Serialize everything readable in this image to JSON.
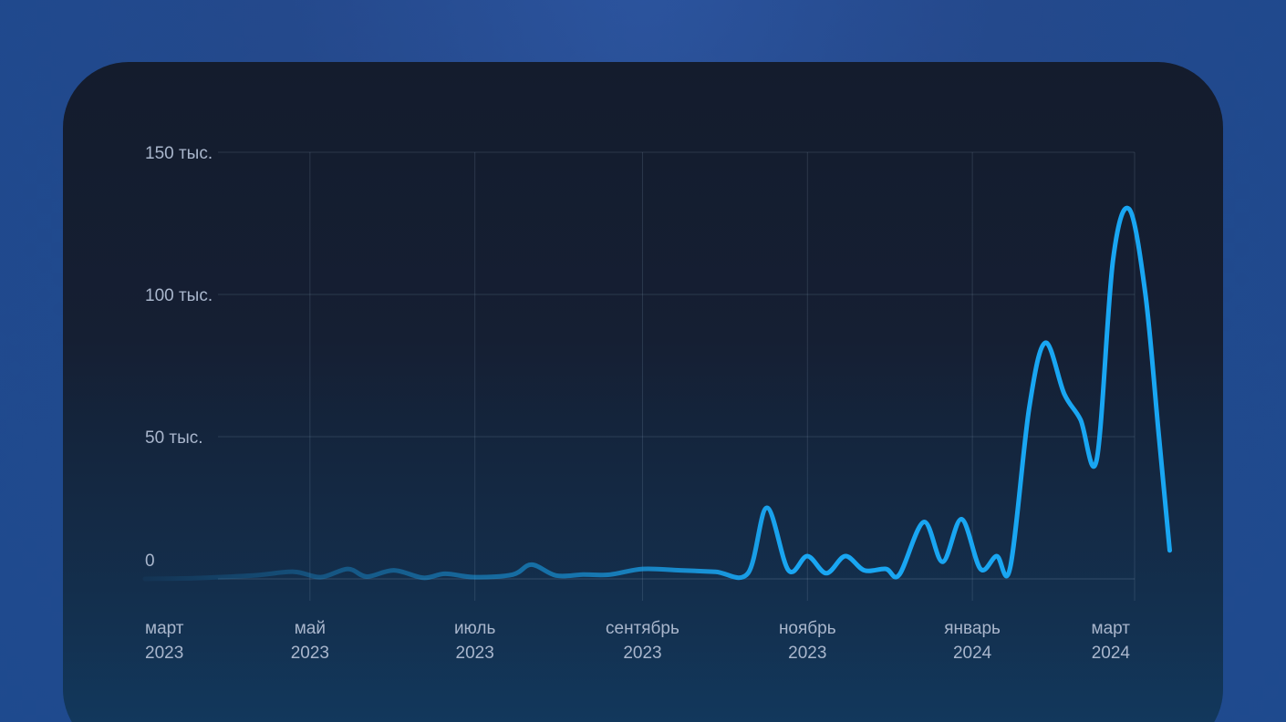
{
  "chart_data": {
    "type": "line",
    "title": "",
    "xlabel": "",
    "ylabel": "",
    "ylim": [
      0,
      150000
    ],
    "grid": true,
    "line_color": "#19a6f2",
    "y_ticks": [
      {
        "value": 0,
        "label": "0"
      },
      {
        "value": 50000,
        "label": "50 тыс."
      },
      {
        "value": 100000,
        "label": "100 тыс."
      },
      {
        "value": 150000,
        "label": "150 тыс."
      }
    ],
    "x_ticks": [
      {
        "date": "2023-03-01",
        "month": "март",
        "year": "2023"
      },
      {
        "date": "2023-05-01",
        "month": "май",
        "year": "2023"
      },
      {
        "date": "2023-07-01",
        "month": "июль",
        "year": "2023"
      },
      {
        "date": "2023-09-01",
        "month": "сентябрь",
        "year": "2023"
      },
      {
        "date": "2023-11-01",
        "month": "ноябрь",
        "year": "2023"
      },
      {
        "date": "2024-01-01",
        "month": "январь",
        "year": "2024"
      },
      {
        "date": "2024-03-01",
        "month": "март",
        "year": "2024"
      }
    ],
    "series": [
      {
        "points": [
          [
            "2023-03-01",
            0
          ],
          [
            "2023-03-20",
            300
          ],
          [
            "2023-04-10",
            1200
          ],
          [
            "2023-04-25",
            2500
          ],
          [
            "2023-05-05",
            600
          ],
          [
            "2023-05-15",
            3500
          ],
          [
            "2023-05-22",
            800
          ],
          [
            "2023-06-01",
            3000
          ],
          [
            "2023-06-12",
            400
          ],
          [
            "2023-06-20",
            1800
          ],
          [
            "2023-07-01",
            600
          ],
          [
            "2023-07-15",
            1500
          ],
          [
            "2023-07-22",
            5000
          ],
          [
            "2023-07-31",
            1200
          ],
          [
            "2023-08-10",
            1500
          ],
          [
            "2023-08-20",
            1500
          ],
          [
            "2023-09-01",
            3500
          ],
          [
            "2023-09-15",
            3000
          ],
          [
            "2023-09-28",
            2500
          ],
          [
            "2023-10-10",
            2000
          ],
          [
            "2023-10-17",
            25000
          ],
          [
            "2023-10-25",
            3000
          ],
          [
            "2023-11-01",
            8000
          ],
          [
            "2023-11-08",
            2000
          ],
          [
            "2023-11-15",
            8000
          ],
          [
            "2023-11-22",
            3000
          ],
          [
            "2023-11-30",
            3500
          ],
          [
            "2023-12-05",
            1500
          ],
          [
            "2023-12-14",
            20000
          ],
          [
            "2023-12-21",
            6000
          ],
          [
            "2023-12-28",
            21000
          ],
          [
            "2024-01-04",
            3500
          ],
          [
            "2024-01-10",
            8000
          ],
          [
            "2024-01-15",
            4000
          ],
          [
            "2024-01-22",
            60000
          ],
          [
            "2024-01-28",
            83000
          ],
          [
            "2024-02-04",
            65000
          ],
          [
            "2024-02-10",
            56000
          ],
          [
            "2024-02-16",
            42000
          ],
          [
            "2024-02-22",
            112000
          ],
          [
            "2024-02-28",
            130000
          ],
          [
            "2024-03-05",
            100000
          ],
          [
            "2024-03-10",
            50000
          ],
          [
            "2024-03-14",
            10000
          ]
        ]
      }
    ]
  }
}
